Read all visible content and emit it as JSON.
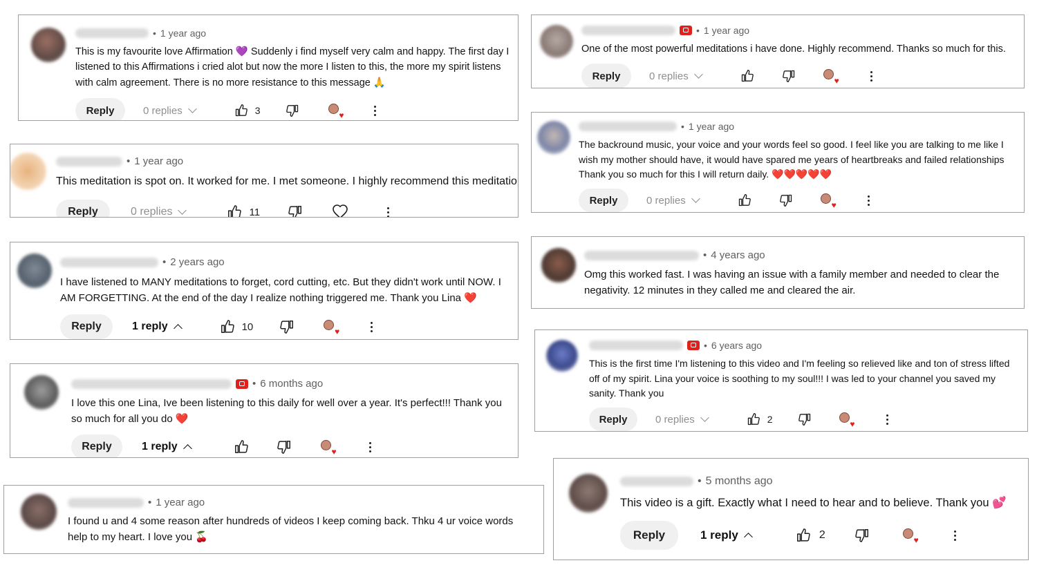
{
  "comments": [
    {
      "time": "1 year ago",
      "text": "This is my favourite love Affirmation 💜 Suddenly i find myself very calm and happy. The first day I listened to this Affirmations i cried alot but now the more I listen to this, the more my spirit listens with calm agreement. There is no more resistance to this message 🙏",
      "reply": "Reply",
      "replies": "0 replies",
      "likes": "3"
    },
    {
      "time": "1 year ago",
      "text": "This meditation is spot on. It worked for me.  I met someone. I highly recommend this meditation",
      "reply": "Reply",
      "replies": "0 replies",
      "likes": "11"
    },
    {
      "time": "2 years ago",
      "text": "I have listened to MANY meditations to forget, cord cutting, etc. But they didn't work until NOW. I AM FORGETTING. At the end of the day I realize nothing triggered me. Thank you Lina ❤️",
      "reply": "Reply",
      "replies": "1 reply",
      "likes": "10"
    },
    {
      "time": "6 months ago",
      "text": "I love this one Lina, Ive been listening to this daily for well over a year. It's perfect!!! Thank you so much for all you do ❤️",
      "reply": "Reply",
      "replies": "1 reply",
      "likes": ""
    },
    {
      "time": "1 year ago",
      "text": "I found u and 4 some reason after hundreds of videos I keep coming back. Thku 4 ur voice words help to my heart. I love you 🍒"
    },
    {
      "time": "1 year ago",
      "text": "One of the most powerful meditations i have done. Highly recommend. Thanks so much for this.",
      "reply": "Reply",
      "replies": "0 replies",
      "likes": ""
    },
    {
      "time": "1 year ago",
      "text": "The backround music, your voice and your words feel so good. I feel like you are talking to me like I wish my mother  should have, it would have spared me years of heartbreaks and failed relationships Thank you so much for this I will return daily. ❤️❤️❤️❤️❤️",
      "reply": "Reply",
      "replies": "0 replies",
      "likes": ""
    },
    {
      "time": "4 years ago",
      "text": "Omg this worked fast. I was having an issue with a family member and needed to clear the negativity. 12 minutes in they called me and cleared the air."
    },
    {
      "time": "6 years ago",
      "text": "This is the first time I'm listening to this video and I'm feeling so relieved like and ton of stress lifted off of my spirit. Lina your voice is soothing to my soul!!! I was led to your channel you saved my sanity. Thank you",
      "reply": "Reply",
      "replies": "0 replies",
      "likes": "2"
    },
    {
      "time": "5 months ago",
      "text": "This video is a gift. Exactly what I need to hear and to believe. Thank you 💕",
      "reply": "Reply",
      "replies": "1 reply",
      "likes": "2"
    }
  ],
  "icons": {
    "like": "thumbs-up-icon",
    "dislike": "thumbs-down-icon",
    "heart": "heart-outline-icon",
    "creator_heart": "creator-heart-avatar-icon",
    "more": "more-vertical-icon",
    "owner": "channel-owner-badge-icon"
  },
  "colors": {
    "owner_badge": "#e0201c",
    "heart": "#e0201c",
    "reply_bg": "#f0f0f0"
  }
}
